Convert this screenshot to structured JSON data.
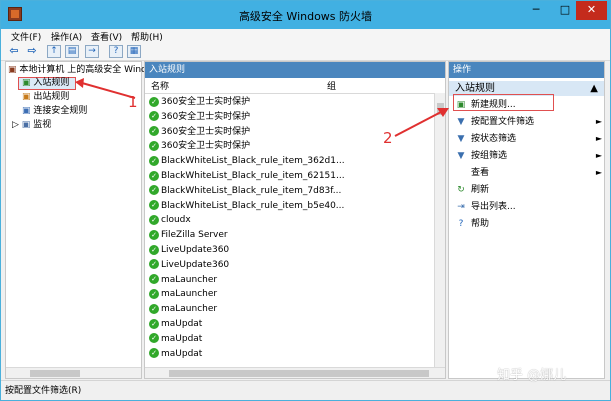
{
  "window": {
    "title": "高级安全 Windows 防火墙",
    "min": "─",
    "max": "□",
    "close": "✕"
  },
  "menu": [
    "文件(F)",
    "操作(A)",
    "查看(V)",
    "帮助(H)"
  ],
  "tree": {
    "root": "本地计算机 上的高级安全 Wind",
    "items": [
      "入站规则",
      "出站规则",
      "连接安全规则",
      "监视"
    ]
  },
  "middle": {
    "title": "入站规则",
    "columns": [
      "名称",
      "组"
    ],
    "rules": [
      "360安全卫士实时保护",
      "360安全卫士实时保护",
      "360安全卫士实时保护",
      "360安全卫士实时保护",
      "BlackWhiteList_Black_rule_item_362d1...",
      "BlackWhiteList_Black_rule_item_62151...",
      "BlackWhiteList_Black_rule_item_7d83f...",
      "BlackWhiteList_Black_rule_item_b5e40...",
      "cloudx",
      "FileZilla Server",
      "LiveUpdate360",
      "LiveUpdate360",
      "maLauncher",
      "maLauncher",
      "maLauncher",
      "maUpdat",
      "maUpdat",
      "maUpdat"
    ]
  },
  "actions": {
    "title": "操作",
    "section": "入站规则",
    "items": [
      {
        "label": "新建规则...",
        "icon": "new-rule-icon",
        "arrow": ""
      },
      {
        "label": "按配置文件筛选",
        "icon": "filter-icon",
        "arrow": "►"
      },
      {
        "label": "按状态筛选",
        "icon": "filter-icon",
        "arrow": "►"
      },
      {
        "label": "按组筛选",
        "icon": "filter-icon",
        "arrow": "►"
      },
      {
        "label": "查看",
        "icon": "view-icon",
        "arrow": "►"
      },
      {
        "label": "刷新",
        "icon": "refresh-icon",
        "arrow": ""
      },
      {
        "label": "导出列表...",
        "icon": "export-icon",
        "arrow": ""
      },
      {
        "label": "帮助",
        "icon": "help-icon",
        "arrow": ""
      }
    ]
  },
  "status": "按配置文件筛选(R)",
  "annotations": [
    "1",
    "2"
  ],
  "watermark": "知乎 @娜儿"
}
